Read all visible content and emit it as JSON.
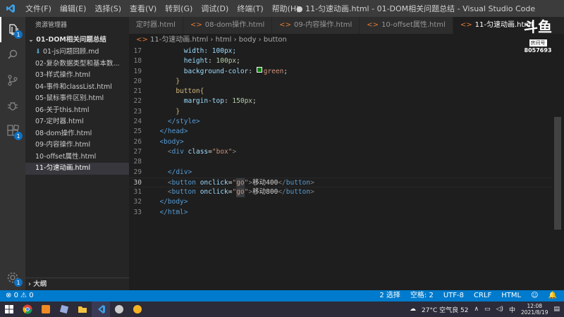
{
  "titlebar": {
    "menu": [
      "文件(F)",
      "编辑(E)",
      "选择(S)",
      "查看(V)",
      "转到(G)",
      "调试(D)",
      "终端(T)",
      "帮助(H)"
    ],
    "window_title": "● 11-匀速动画.html - 01-DOM相关问题总结 - Visual Studio Code"
  },
  "activitybar": {
    "badges": {
      "extensions": "1",
      "settings": "1"
    }
  },
  "sidebar": {
    "title": "资源管理器",
    "folder": "01-DOM相关问题总结",
    "files": [
      "01-js问题回顾.md",
      "02-复杂数据类型和基本数...",
      "03-样式操作.html",
      "04-事件和classList.html",
      "05-鼠标事件区别.html",
      "06-关于this.html",
      "07-定时器.html",
      "08-dom操作.html",
      "09-内容操作.html",
      "10-offset属性.html",
      "11-匀速动画.html"
    ],
    "outline": "大纲"
  },
  "tabs": [
    "定时器.html",
    "08-dom操作.html",
    "09-内容操作.html",
    "10-offset属性.html",
    "11-匀速动画.html"
  ],
  "breadcrumb": {
    "file": "11-匀速动画.html",
    "items": [
      "html",
      "body",
      "button"
    ]
  },
  "editor": {
    "line_numbers": [
      "17",
      "18",
      "19",
      "20",
      "21",
      "22",
      "23",
      "24",
      "25",
      "26",
      "27",
      "28",
      "29",
      "30",
      "31",
      "32",
      "33"
    ],
    "l17": "width: 100px;",
    "l18_prop": "height",
    "l18_val": "100px",
    "l19_prop": "background-color",
    "l19_val": "green",
    "l20": "}",
    "l21": "button{",
    "l22_prop": "margin-top",
    "l22_val": "150px",
    "l23": "}",
    "l24": "</style>",
    "l25": "</head>",
    "l26": "<body>",
    "l27_tag": "div",
    "l27_attr": "class",
    "l27_val": "\"box\"",
    "l29": "</div>",
    "l30_attr": "onclick",
    "l30_val": "go",
    "l30_text": "移动400",
    "l31_attr": "onclick",
    "l31_val": "go",
    "l31_text": "移动800",
    "l32": "</body>",
    "l33": "</html>"
  },
  "statusbar": {
    "errors": "0",
    "warnings": "0",
    "selection": "2 选择",
    "spaces": "空格: 2",
    "encoding": "UTF-8",
    "eol": "CRLF",
    "language": "HTML"
  },
  "taskbar": {
    "weather": "27°C 空气良 52",
    "ime": "中",
    "time": "12:08",
    "date": "2021/8/19"
  },
  "watermark": {
    "logo": "斗鱼",
    "sub": "房间号",
    "room": "8057693"
  }
}
